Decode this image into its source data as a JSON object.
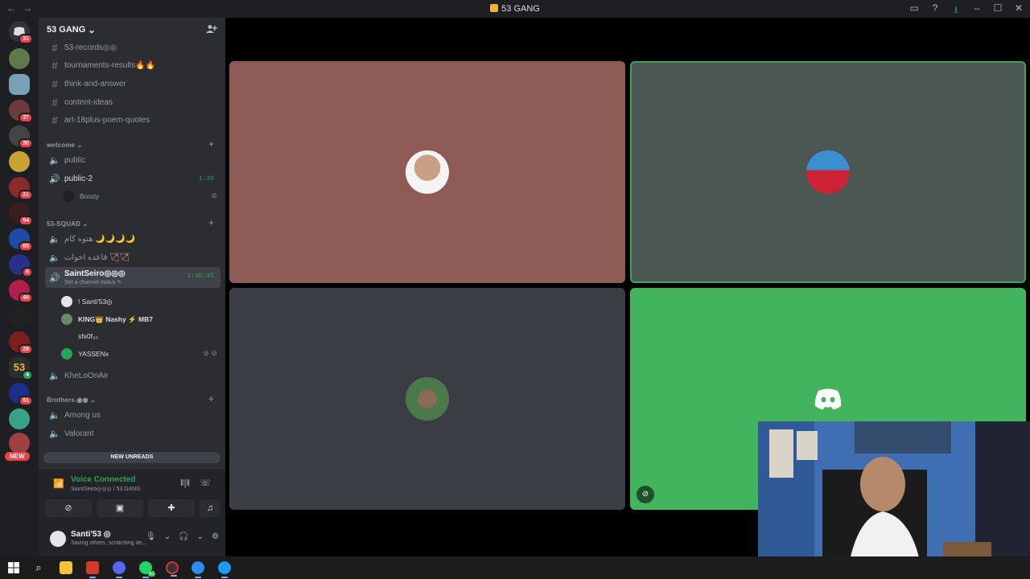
{
  "window": {
    "title": "53 GANG",
    "nav_back": "←",
    "nav_forward": "→",
    "icons": [
      "inbox-icon",
      "help-icon",
      "download-icon",
      "minimize-icon",
      "maximize-icon",
      "close-icon"
    ],
    "icon_glyphs": [
      "▭",
      "?",
      "⭳",
      "–",
      "☐",
      "✕"
    ]
  },
  "guilds": {
    "badges": [
      "31",
      "",
      "",
      "37",
      "30",
      "",
      "21",
      "54",
      "65",
      "6",
      "40",
      "",
      "28",
      "4",
      "51",
      "",
      "",
      ""
    ],
    "new_label": "NEW"
  },
  "server": {
    "name": "53 GANG",
    "chevron": "⌄"
  },
  "channels": {
    "text": [
      {
        "name": "53-records◎◎"
      },
      {
        "name": "tournaments-results🔥🔥"
      },
      {
        "name": "think-and-answer"
      },
      {
        "name": "content-ideas"
      },
      {
        "name": "art-18plus-poem-quotes"
      }
    ],
    "cat_welcome": "welcome",
    "public": "public",
    "public2": "public-2",
    "public2_time": "1:30",
    "boody": "Boody",
    "cat_squad": "53-SQUAD",
    "squad_ch1": "هتوه كام 🌙🌙🌙🌙",
    "squad_ch2": "قاعده اخوات 🏹🏹",
    "active_channel": "SaintSeiro◎◎◎",
    "active_time": "1:46:45",
    "active_sub": "Set a channel status ✎",
    "members": [
      {
        "name": "! Santi'53◎"
      },
      {
        "name": "KING👑 Nashy ⚡ MB7"
      },
      {
        "name": "sfs0f₃₃"
      },
      {
        "name": "YASSENx"
      }
    ],
    "kheloonair": "KheLoOnAir",
    "cat_brothers": "Brothers.◉◉",
    "among_us": "Among us",
    "valorant": "Valorant",
    "new_unreads": "NEW UNREADS"
  },
  "voice": {
    "status": "Voice Connected",
    "location": "SaintSeiro◎◎◎ / 53 GANG"
  },
  "user": {
    "name": "Santi'53 ◎",
    "status": "Saving others, scratching de..."
  },
  "tiles": {
    "tile4_muted": true
  },
  "taskbar": {
    "whatsapp_count": "47"
  }
}
